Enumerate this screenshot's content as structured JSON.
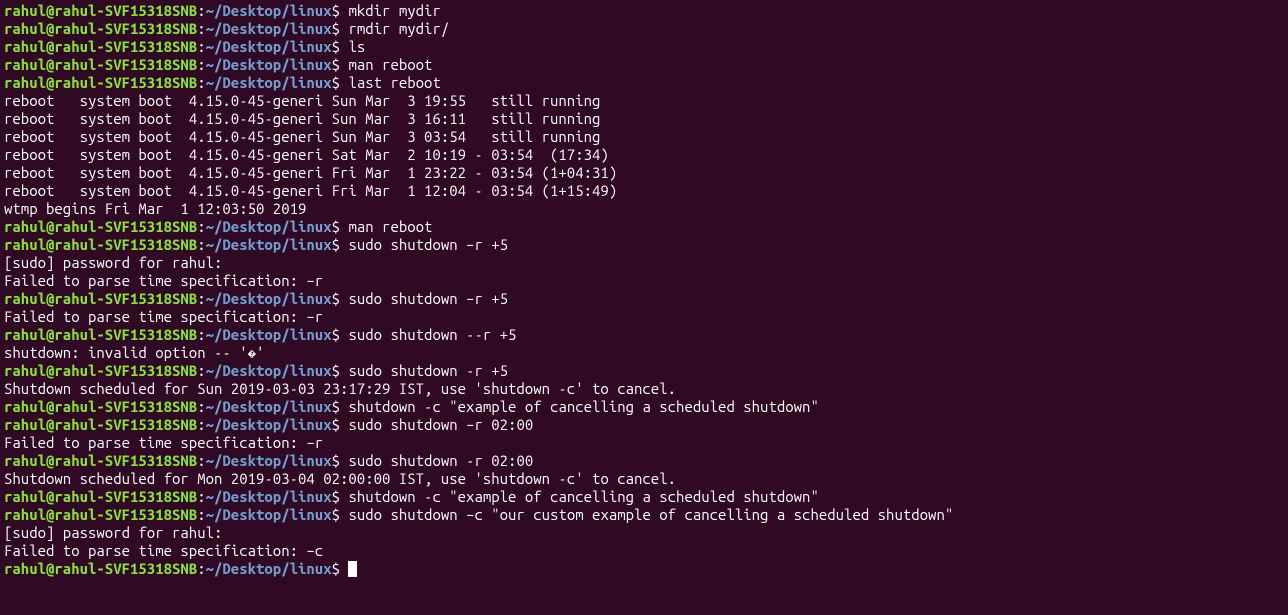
{
  "prompt": {
    "user_host": "rahul@rahul-SVF15318SNB",
    "colon": ":",
    "path": "~/Desktop/linux",
    "dollar": "$ "
  },
  "lines": [
    {
      "type": "prompt",
      "cmd": "mkdir mydir"
    },
    {
      "type": "prompt",
      "cmd": "rmdir mydir/"
    },
    {
      "type": "prompt",
      "cmd": "ls"
    },
    {
      "type": "prompt",
      "cmd": "man reboot"
    },
    {
      "type": "prompt",
      "cmd": "last reboot"
    },
    {
      "type": "output",
      "text": "reboot   system boot  4.15.0-45-generi Sun Mar  3 19:55   still running"
    },
    {
      "type": "output",
      "text": "reboot   system boot  4.15.0-45-generi Sun Mar  3 16:11   still running"
    },
    {
      "type": "output",
      "text": "reboot   system boot  4.15.0-45-generi Sun Mar  3 03:54   still running"
    },
    {
      "type": "output",
      "text": "reboot   system boot  4.15.0-45-generi Sat Mar  2 10:19 - 03:54  (17:34)"
    },
    {
      "type": "output",
      "text": "reboot   system boot  4.15.0-45-generi Fri Mar  1 23:22 - 03:54 (1+04:31)"
    },
    {
      "type": "output",
      "text": "reboot   system boot  4.15.0-45-generi Fri Mar  1 12:04 - 03:54 (1+15:49)"
    },
    {
      "type": "output",
      "text": ""
    },
    {
      "type": "output",
      "text": "wtmp begins Fri Mar  1 12:03:50 2019"
    },
    {
      "type": "prompt",
      "cmd": "man reboot"
    },
    {
      "type": "prompt",
      "cmd": "sudo shutdown –r +5"
    },
    {
      "type": "output",
      "text": "[sudo] password for rahul: "
    },
    {
      "type": "output",
      "text": "Failed to parse time specification: –r"
    },
    {
      "type": "prompt",
      "cmd": "sudo shutdown –r +5"
    },
    {
      "type": "output",
      "text": "Failed to parse time specification: –r"
    },
    {
      "type": "prompt",
      "cmd": "sudo shutdown --r +5"
    },
    {
      "type": "output",
      "text": "shutdown: invalid option -- '�'"
    },
    {
      "type": "prompt",
      "cmd": "sudo shutdown -r +5"
    },
    {
      "type": "output",
      "text": "Shutdown scheduled for Sun 2019-03-03 23:17:29 IST, use 'shutdown -c' to cancel."
    },
    {
      "type": "prompt",
      "cmd": "shutdown -c \"example of cancelling a scheduled shutdown\""
    },
    {
      "type": "prompt",
      "cmd": "sudo shutdown –r 02:00"
    },
    {
      "type": "output",
      "text": "Failed to parse time specification: –r"
    },
    {
      "type": "prompt",
      "cmd": "sudo shutdown -r 02:00"
    },
    {
      "type": "output",
      "text": "Shutdown scheduled for Mon 2019-03-04 02:00:00 IST, use 'shutdown -c' to cancel."
    },
    {
      "type": "prompt",
      "cmd": "shutdown -c \"example of cancelling a scheduled shutdown\""
    },
    {
      "type": "prompt",
      "cmd": "sudo shutdown –c \"our custom example of cancelling a scheduled shutdown\""
    },
    {
      "type": "output",
      "text": "[sudo] password for rahul: "
    },
    {
      "type": "output",
      "text": "Failed to parse time specification: –c"
    },
    {
      "type": "prompt",
      "cmd": "",
      "cursor": true
    }
  ]
}
